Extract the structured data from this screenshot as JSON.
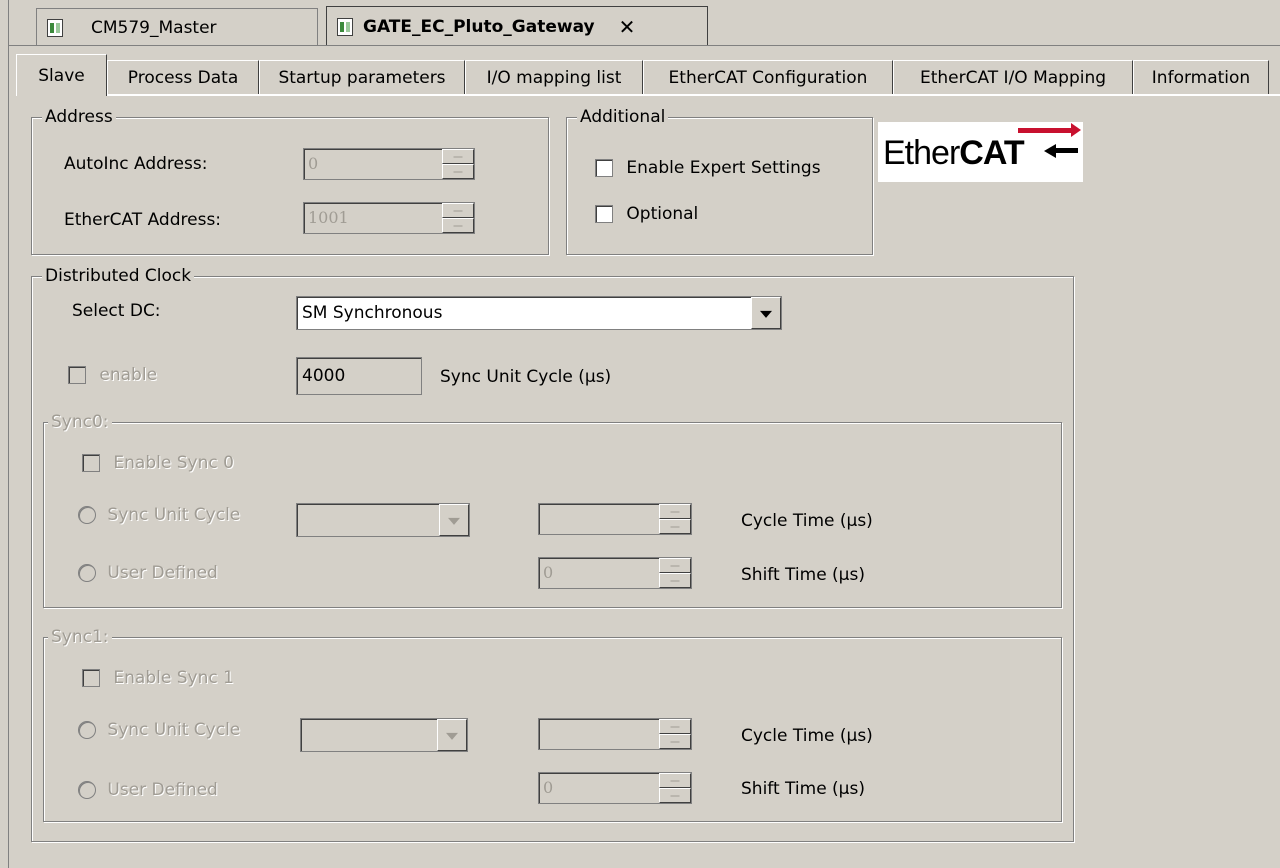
{
  "editor_tabs": [
    {
      "label": "CM579_Master"
    },
    {
      "label": "GATE_EC_Pluto_Gateway"
    }
  ],
  "property_tabs": [
    {
      "label": "Slave"
    },
    {
      "label": "Process Data"
    },
    {
      "label": "Startup parameters"
    },
    {
      "label": "I/O mapping list"
    },
    {
      "label": "EtherCAT Configuration"
    },
    {
      "label": "EtherCAT I/O Mapping"
    },
    {
      "label": "Information"
    }
  ],
  "address": {
    "title": "Address",
    "autoinc_label": "AutoInc Address:",
    "autoinc_value": "0",
    "ethercat_label": "EtherCAT Address:",
    "ethercat_value": "1001"
  },
  "additional": {
    "title": "Additional",
    "expert_label": "Enable Expert Settings",
    "optional_label": "Optional"
  },
  "logo": {
    "text_light": "Ether",
    "text_bold": "CAT"
  },
  "dc": {
    "title": "Distributed Clock",
    "select_label": "Select DC:",
    "select_value": "SM Synchronous",
    "enable_label": "enable",
    "cycle_value": "4000",
    "cycle_label": "Sync Unit Cycle (µs)"
  },
  "sync0": {
    "title": "Sync0:",
    "enable_label": "Enable Sync 0",
    "radio_sync_label": "Sync Unit Cycle",
    "radio_user_label": "User Defined",
    "cycle_time_label": "Cycle Time (µs)",
    "shift_value": "0",
    "shift_time_label": "Shift Time (µs)"
  },
  "sync1": {
    "title": "Sync1:",
    "enable_label": "Enable Sync 1",
    "radio_sync_label": "Sync Unit Cycle",
    "radio_user_label": "User Defined",
    "cycle_time_label": "Cycle Time (µs)",
    "shift_value": "0",
    "shift_time_label": "Shift Time (µs)"
  }
}
